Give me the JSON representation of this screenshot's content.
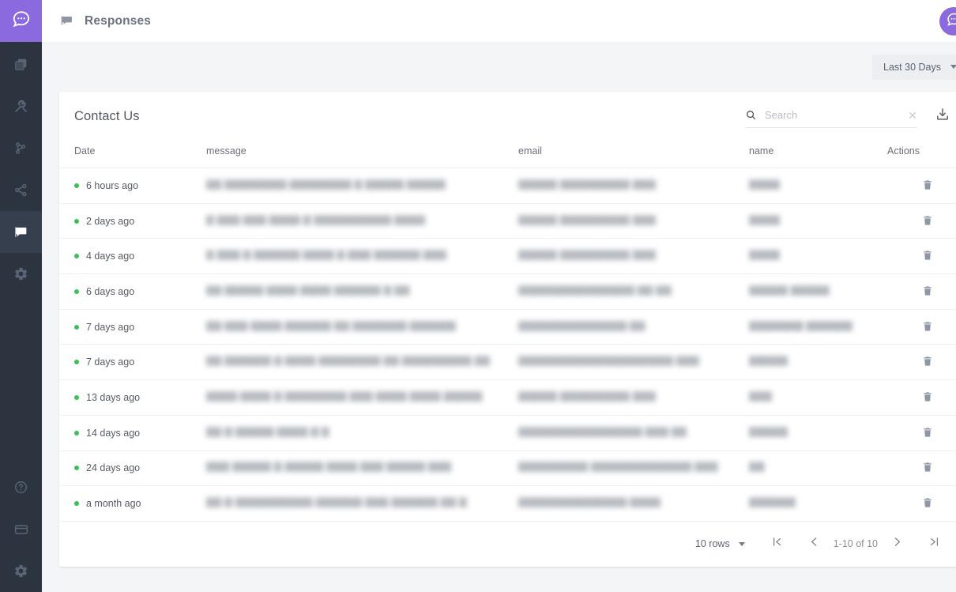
{
  "sidebar": {
    "logo_icon": "chat-bubble-logo-icon",
    "items": [
      {
        "icon": "layers-icon",
        "name": "sidebar-item-layers",
        "active": false
      },
      {
        "icon": "tools-icon",
        "name": "sidebar-item-tools",
        "active": false
      },
      {
        "icon": "branch-icon",
        "name": "sidebar-item-branch",
        "active": false
      },
      {
        "icon": "share-icon",
        "name": "sidebar-item-share",
        "active": false
      },
      {
        "icon": "chat-icon",
        "name": "sidebar-item-responses",
        "active": true
      },
      {
        "icon": "gear-icon",
        "name": "sidebar-item-settings",
        "active": false
      }
    ],
    "bottom_items": [
      {
        "icon": "help-circle-icon",
        "name": "sidebar-item-help"
      },
      {
        "icon": "credit-card-icon",
        "name": "sidebar-item-billing"
      },
      {
        "icon": "gear-icon",
        "name": "sidebar-item-preferences"
      }
    ]
  },
  "topbar": {
    "icon": "chat-icon",
    "title": "Responses",
    "avatar_icon": "chat-bubble-icon"
  },
  "filters": {
    "date_range_label": "Last 30 Days"
  },
  "card": {
    "title": "Contact Us",
    "search": {
      "placeholder": "Search",
      "value": "",
      "search_icon": "search-icon",
      "clear_icon": "close-icon"
    },
    "download_icon": "download-icon",
    "columns": [
      "Date",
      "message",
      "email",
      "name",
      "Actions"
    ],
    "rows": [
      {
        "date": "6 hours ago",
        "message": "▇▇ ▇▇▇▇▇▇▇▇ ▇▇▇▇▇▇▇▇ ▇ ▇▇▇▇▇ ▇▇▇▇▇",
        "email": "▇▇▇▇▇ ▇▇▇▇▇▇▇▇▇ ▇▇▇",
        "name": "▇▇▇▇",
        "action_icon": "trash-icon"
      },
      {
        "date": "2 days ago",
        "message": "▇ ▇▇▇ ▇▇▇ ▇▇▇▇ ▇ ▇▇▇▇▇▇▇▇▇▇ ▇▇▇▇",
        "email": "▇▇▇▇▇ ▇▇▇▇▇▇▇▇▇ ▇▇▇",
        "name": "▇▇▇▇",
        "action_icon": "trash-icon"
      },
      {
        "date": "4 days ago",
        "message": "▇ ▇▇▇ ▇ ▇▇▇▇▇▇ ▇▇▇▇ ▇ ▇▇▇ ▇▇▇▇▇▇ ▇▇▇",
        "email": "▇▇▇▇▇ ▇▇▇▇▇▇▇▇▇ ▇▇▇",
        "name": "▇▇▇▇",
        "action_icon": "trash-icon"
      },
      {
        "date": "6 days ago",
        "message": "▇▇ ▇▇▇▇▇ ▇▇▇▇ ▇▇▇▇ ▇▇▇▇▇▇  ▇ ▇▇",
        "email": "▇▇▇▇▇▇▇▇▇▇▇▇▇▇▇ ▇▇ ▇▇",
        "name": "▇▇▇▇▇ ▇▇▇▇▇",
        "action_icon": "trash-icon"
      },
      {
        "date": "7 days ago",
        "message": "▇▇ ▇▇▇ ▇▇▇▇ ▇▇▇▇▇▇ ▇▇ ▇▇▇▇▇▇▇ ▇▇▇▇▇▇",
        "email": "▇▇▇▇▇▇▇▇▇▇▇▇▇▇ ▇▇",
        "name": "▇▇▇▇▇▇▇ ▇▇▇▇▇▇",
        "action_icon": "trash-icon"
      },
      {
        "date": "7 days ago",
        "message": "▇▇ ▇▇▇▇▇▇ ▇ ▇▇▇▇ ▇▇▇▇▇▇▇▇ ▇▇ ▇▇▇▇▇▇▇▇▇ ▇▇",
        "email": "▇▇▇▇▇▇▇▇▇▇▇▇▇▇▇▇▇▇▇▇ ▇▇▇",
        "name": "▇▇▇▇▇",
        "action_icon": "trash-icon"
      },
      {
        "date": "13 days ago",
        "message": "▇▇▇▇ ▇▇▇▇ ▇ ▇▇▇▇▇▇▇▇ ▇▇▇ ▇▇▇▇ ▇▇▇▇ ▇▇▇▇▇",
        "email": "▇▇▇▇▇ ▇▇▇▇▇▇▇▇▇ ▇▇▇",
        "name": "▇▇▇",
        "action_icon": "trash-icon"
      },
      {
        "date": "14 days ago",
        "message": "▇▇ ▇ ▇▇▇▇▇ ▇▇▇▇ ▇ ▇",
        "email": "▇▇▇▇▇▇▇▇▇▇▇▇▇▇▇▇ ▇▇▇ ▇▇",
        "name": "▇▇▇▇▇",
        "action_icon": "trash-icon"
      },
      {
        "date": "24 days ago",
        "message": "▇▇▇ ▇▇▇▇▇ ▇ ▇▇▇▇▇ ▇▇▇▇ ▇▇▇ ▇▇▇▇▇ ▇▇▇",
        "email": "▇▇▇▇▇▇▇▇▇ ▇▇▇▇▇▇▇▇▇▇▇▇▇ ▇▇▇",
        "name": "▇▇",
        "action_icon": "trash-icon"
      },
      {
        "date": "a month ago",
        "message": "▇▇ ▇ ▇▇▇▇▇▇▇▇▇▇ ▇▇▇▇▇▇ ▇▇▇ ▇▇▇▇▇▇ ▇▇ ▇",
        "email": "▇▇▇▇▇▇▇▇▇▇▇▇▇▇ ▇▇▇▇",
        "name": "▇▇▇▇▇▇",
        "action_icon": "trash-icon"
      }
    ]
  },
  "pagination": {
    "rows_per_page_label": "10 rows",
    "range_label": "1-10 of 10",
    "first_icon": "first-page-icon",
    "prev_icon": "chevron-left-icon",
    "next_icon": "chevron-right-icon",
    "last_icon": "last-page-icon"
  },
  "colors": {
    "accent_purple": "#8b6ae0",
    "sidebar_bg": "#2c3440",
    "status_green": "#3dbf56",
    "page_bg": "#f4f5f7"
  }
}
